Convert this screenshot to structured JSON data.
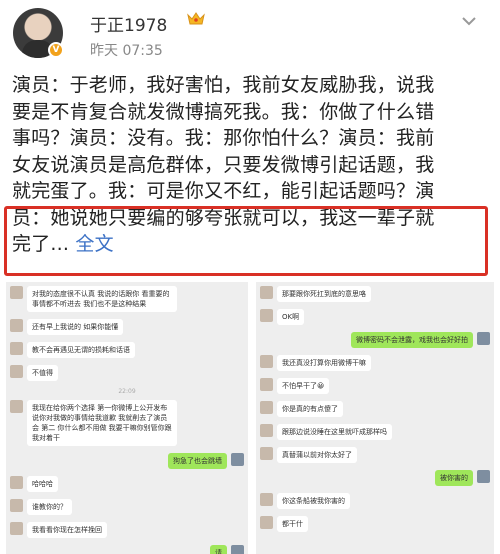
{
  "header": {
    "username": "于正1978",
    "timestamp": "昨天 07:35",
    "verified_badge": "V",
    "icons": [
      "avatar",
      "verified-badge-icon",
      "crown-icon",
      "chevron-down-icon"
    ]
  },
  "post": {
    "lines": [
      "演员：于老师，我好害怕，我前女友威胁我，说我",
      "要是不肯复合就发微博搞死我。我：你做了什么错",
      "事吗？演员：没有。我：那你怕什么？演员：我前",
      "女友说演员是高危群体，只要发微博引起话题，我",
      "就完蛋了。我：可是你又不红，能引起话题吗？演",
      "员：她说她只要编的够夸张就可以，我这一辈子就",
      "完了..."
    ],
    "more_link": "全文",
    "highlight_color": "#d93025",
    "link_color": "#3d72c6"
  },
  "chat": {
    "left": [
      {
        "side": "in",
        "text": "对我的态度很不认真 我说的话跟你 看重要的事情都不听进去 我们也不是这种结果"
      },
      {
        "side": "in",
        "text": "还有早上我说的 如果你能懂"
      },
      {
        "side": "in",
        "text": "教不会再遇见无谓的损耗和话语"
      },
      {
        "side": "in",
        "text": "不值得"
      },
      {
        "side": "time",
        "text": "22:09"
      },
      {
        "side": "in",
        "text": "我现在给你两个选择 第一你微博上公开发布说你对我做的事情给我道歉 我就削去了演员会 第二 你什么都不用做 我要干嘛你别管你跟我对着干"
      },
      {
        "side": "me",
        "text": "狗急了也会跳墙"
      },
      {
        "side": "in",
        "text": "哈哈哈"
      },
      {
        "side": "in",
        "text": "谁教你的？"
      },
      {
        "side": "in",
        "text": "我看看你现在怎样挽回"
      },
      {
        "side": "me",
        "text": "请"
      }
    ],
    "right": [
      {
        "side": "in",
        "text": "那要跟你死扛到底的意思咯"
      },
      {
        "side": "in",
        "text": "OK啊"
      },
      {
        "side": "me",
        "text": "微博密码不会泄露，戏我也会好好拍"
      },
      {
        "side": "in",
        "text": "我还真没打算你用微博干嘛"
      },
      {
        "side": "in",
        "text": "不怕早干了😀"
      },
      {
        "side": "in",
        "text": "你是真的有点傻了"
      },
      {
        "side": "in",
        "text": "跟那边说没睡在这里就吓成那样吗"
      },
      {
        "side": "in",
        "text": "真替蒲以前对你太好了"
      },
      {
        "side": "me",
        "text": "被你害的"
      },
      {
        "side": "in",
        "text": "你这条船被我你害的"
      },
      {
        "side": "in",
        "text": "都干什"
      }
    ]
  }
}
